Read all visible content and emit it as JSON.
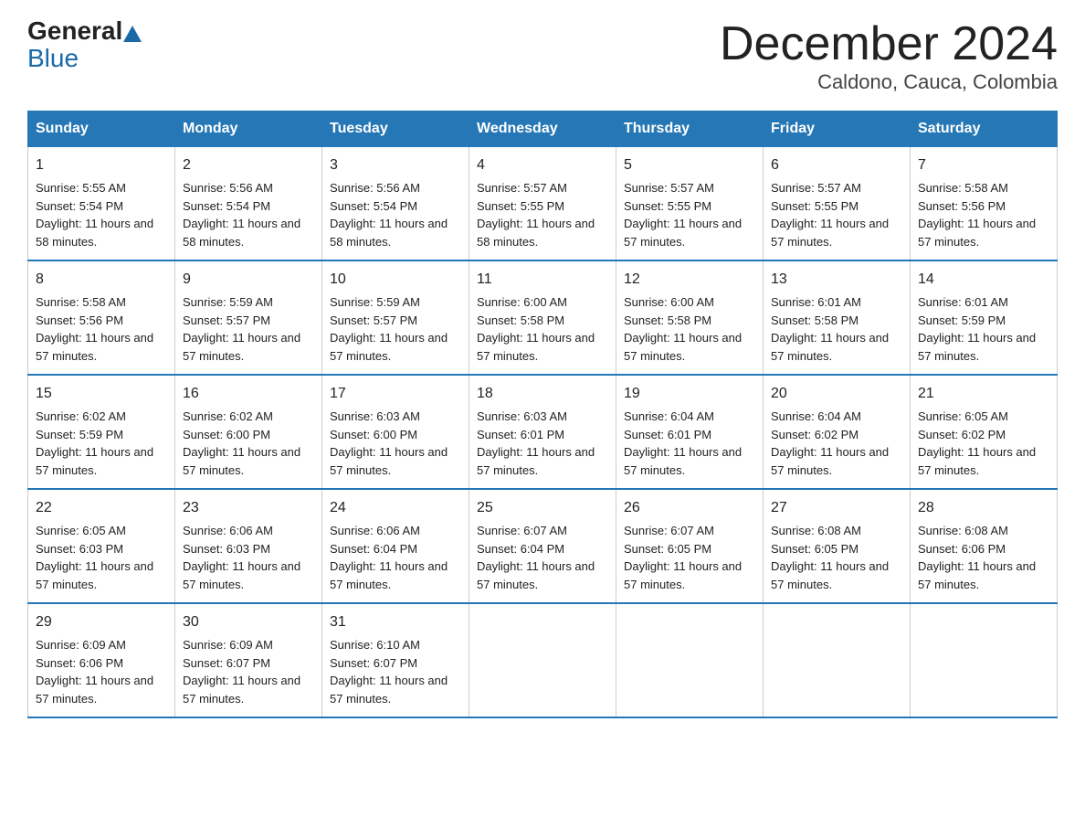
{
  "logo": {
    "general": "General",
    "blue": "Blue"
  },
  "title": "December 2024",
  "location": "Caldono, Cauca, Colombia",
  "days_header": [
    "Sunday",
    "Monday",
    "Tuesday",
    "Wednesday",
    "Thursday",
    "Friday",
    "Saturday"
  ],
  "weeks": [
    [
      {
        "day": "1",
        "sunrise": "5:55 AM",
        "sunset": "5:54 PM",
        "daylight": "11 hours and 58 minutes."
      },
      {
        "day": "2",
        "sunrise": "5:56 AM",
        "sunset": "5:54 PM",
        "daylight": "11 hours and 58 minutes."
      },
      {
        "day": "3",
        "sunrise": "5:56 AM",
        "sunset": "5:54 PM",
        "daylight": "11 hours and 58 minutes."
      },
      {
        "day": "4",
        "sunrise": "5:57 AM",
        "sunset": "5:55 PM",
        "daylight": "11 hours and 58 minutes."
      },
      {
        "day": "5",
        "sunrise": "5:57 AM",
        "sunset": "5:55 PM",
        "daylight": "11 hours and 57 minutes."
      },
      {
        "day": "6",
        "sunrise": "5:57 AM",
        "sunset": "5:55 PM",
        "daylight": "11 hours and 57 minutes."
      },
      {
        "day": "7",
        "sunrise": "5:58 AM",
        "sunset": "5:56 PM",
        "daylight": "11 hours and 57 minutes."
      }
    ],
    [
      {
        "day": "8",
        "sunrise": "5:58 AM",
        "sunset": "5:56 PM",
        "daylight": "11 hours and 57 minutes."
      },
      {
        "day": "9",
        "sunrise": "5:59 AM",
        "sunset": "5:57 PM",
        "daylight": "11 hours and 57 minutes."
      },
      {
        "day": "10",
        "sunrise": "5:59 AM",
        "sunset": "5:57 PM",
        "daylight": "11 hours and 57 minutes."
      },
      {
        "day": "11",
        "sunrise": "6:00 AM",
        "sunset": "5:58 PM",
        "daylight": "11 hours and 57 minutes."
      },
      {
        "day": "12",
        "sunrise": "6:00 AM",
        "sunset": "5:58 PM",
        "daylight": "11 hours and 57 minutes."
      },
      {
        "day": "13",
        "sunrise": "6:01 AM",
        "sunset": "5:58 PM",
        "daylight": "11 hours and 57 minutes."
      },
      {
        "day": "14",
        "sunrise": "6:01 AM",
        "sunset": "5:59 PM",
        "daylight": "11 hours and 57 minutes."
      }
    ],
    [
      {
        "day": "15",
        "sunrise": "6:02 AM",
        "sunset": "5:59 PM",
        "daylight": "11 hours and 57 minutes."
      },
      {
        "day": "16",
        "sunrise": "6:02 AM",
        "sunset": "6:00 PM",
        "daylight": "11 hours and 57 minutes."
      },
      {
        "day": "17",
        "sunrise": "6:03 AM",
        "sunset": "6:00 PM",
        "daylight": "11 hours and 57 minutes."
      },
      {
        "day": "18",
        "sunrise": "6:03 AM",
        "sunset": "6:01 PM",
        "daylight": "11 hours and 57 minutes."
      },
      {
        "day": "19",
        "sunrise": "6:04 AM",
        "sunset": "6:01 PM",
        "daylight": "11 hours and 57 minutes."
      },
      {
        "day": "20",
        "sunrise": "6:04 AM",
        "sunset": "6:02 PM",
        "daylight": "11 hours and 57 minutes."
      },
      {
        "day": "21",
        "sunrise": "6:05 AM",
        "sunset": "6:02 PM",
        "daylight": "11 hours and 57 minutes."
      }
    ],
    [
      {
        "day": "22",
        "sunrise": "6:05 AM",
        "sunset": "6:03 PM",
        "daylight": "11 hours and 57 minutes."
      },
      {
        "day": "23",
        "sunrise": "6:06 AM",
        "sunset": "6:03 PM",
        "daylight": "11 hours and 57 minutes."
      },
      {
        "day": "24",
        "sunrise": "6:06 AM",
        "sunset": "6:04 PM",
        "daylight": "11 hours and 57 minutes."
      },
      {
        "day": "25",
        "sunrise": "6:07 AM",
        "sunset": "6:04 PM",
        "daylight": "11 hours and 57 minutes."
      },
      {
        "day": "26",
        "sunrise": "6:07 AM",
        "sunset": "6:05 PM",
        "daylight": "11 hours and 57 minutes."
      },
      {
        "day": "27",
        "sunrise": "6:08 AM",
        "sunset": "6:05 PM",
        "daylight": "11 hours and 57 minutes."
      },
      {
        "day": "28",
        "sunrise": "6:08 AM",
        "sunset": "6:06 PM",
        "daylight": "11 hours and 57 minutes."
      }
    ],
    [
      {
        "day": "29",
        "sunrise": "6:09 AM",
        "sunset": "6:06 PM",
        "daylight": "11 hours and 57 minutes."
      },
      {
        "day": "30",
        "sunrise": "6:09 AM",
        "sunset": "6:07 PM",
        "daylight": "11 hours and 57 minutes."
      },
      {
        "day": "31",
        "sunrise": "6:10 AM",
        "sunset": "6:07 PM",
        "daylight": "11 hours and 57 minutes."
      },
      null,
      null,
      null,
      null
    ]
  ]
}
